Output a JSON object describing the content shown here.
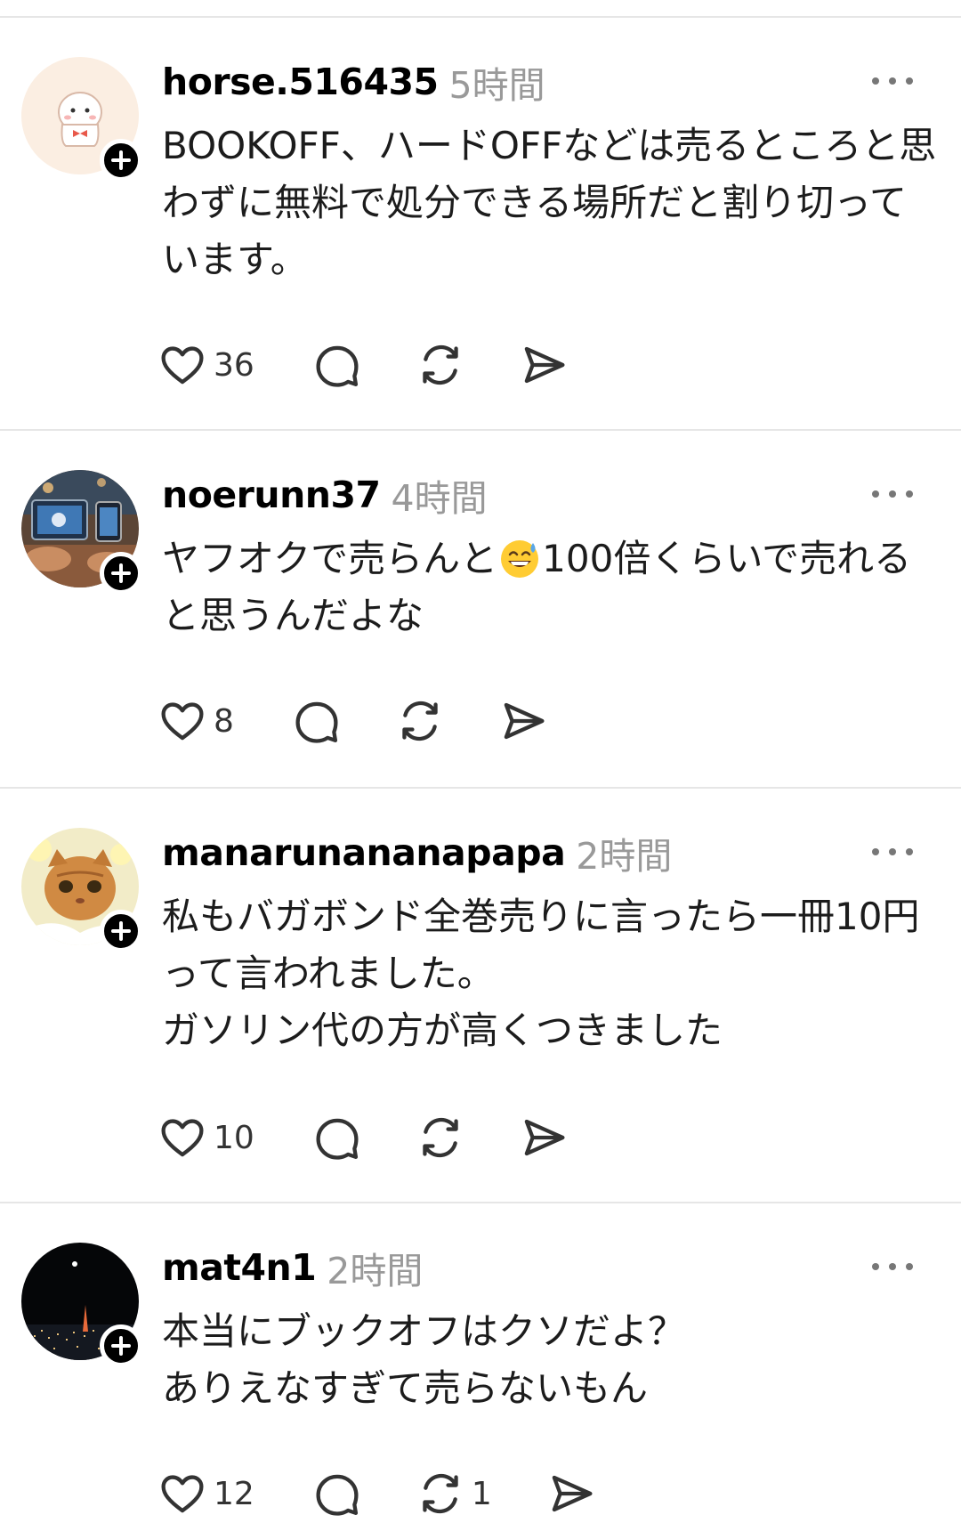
{
  "posts": [
    {
      "username": "horse.516435",
      "time": "5時間",
      "text": "BOOKOFF、ハードOFFなどは売るところと思わずに無料で処分できる場所だと割り切っています。",
      "likes": "36",
      "reposts": ""
    },
    {
      "username": "noerunn37",
      "time": "4時間",
      "text_before": "ヤフオクで売らんと",
      "emoji": "grinning-sweat-emoji",
      "text_after": "100倍くらいで売れると思うんだよな",
      "likes": "8",
      "reposts": ""
    },
    {
      "username": "manarunananapapa",
      "time": "2時間",
      "text": "私もバガボンド全巻売りに言ったら一冊10円って言われました。\nガソリン代の方が高くつきました",
      "likes": "10",
      "reposts": ""
    },
    {
      "username": "mat4n1",
      "time": "2時間",
      "text": "本当にブックオフはクソだよ？\nありえなすぎて売らないもん",
      "likes": "12",
      "reposts": "1"
    }
  ],
  "icons": {
    "like": "heart-icon",
    "reply": "comment-icon",
    "repost": "repost-icon",
    "share": "send-icon",
    "more": "more-icon",
    "follow": "plus-icon"
  },
  "colors": {
    "text": "#1c1c1c",
    "secondary": "#999999",
    "divider": "#e6e6e6",
    "icon": "#333333"
  }
}
